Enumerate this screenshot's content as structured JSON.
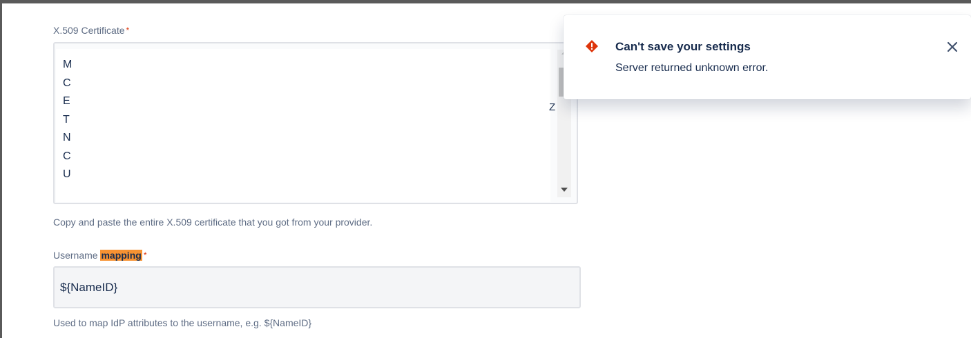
{
  "certificate": {
    "label": "X.509 Certificate",
    "required_mark": "*",
    "visible_lines": [
      "M",
      "C",
      "E",
      "T",
      "N",
      "C",
      "U"
    ],
    "trailing_char": "Z",
    "help": "Copy and paste the entire X.509 certificate that you got from your provider."
  },
  "username_mapping": {
    "label_prefix": "Username ",
    "label_highlight": "mapping",
    "required_mark": "*",
    "value": "${NameID}",
    "help": "Used to map IdP attributes to the username, e.g. ${NameID}"
  },
  "flag": {
    "icon": "error-icon",
    "title": "Can't save your settings",
    "description": "Server returned unknown error.",
    "close_icon": "close-icon"
  },
  "colors": {
    "error": "#de350b",
    "highlight": "#f79232",
    "text": "#172b4d",
    "subtle_text": "#5e6c84"
  }
}
